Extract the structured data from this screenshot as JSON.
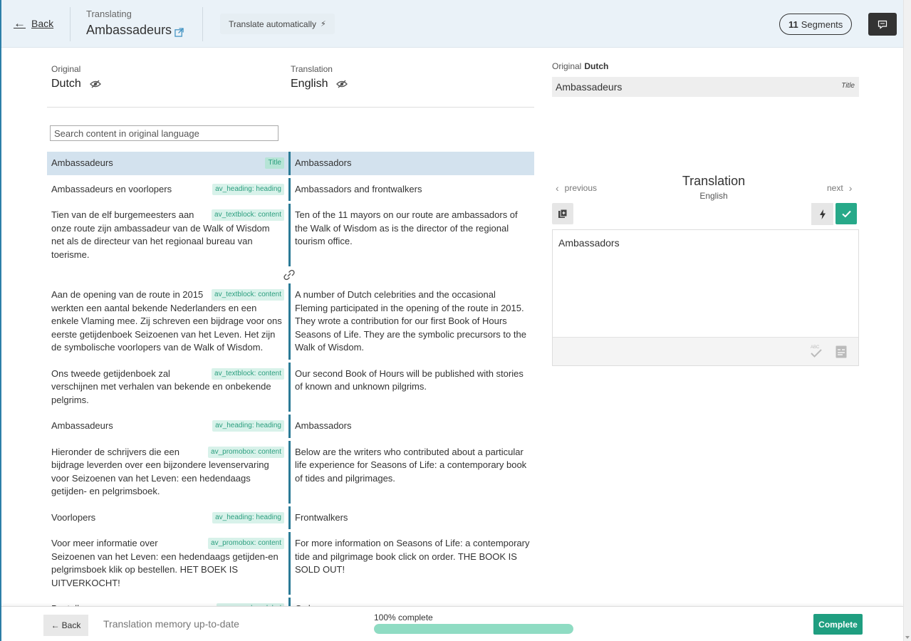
{
  "header": {
    "back_label": "Back",
    "translating_label": "Translating",
    "title": "Ambassadeurs",
    "translate_auto_label": "Translate automatically",
    "segments_count": "11",
    "segments_label": "Segments"
  },
  "languages": {
    "original_label": "Original",
    "original_name": "Dutch",
    "translation_label": "Translation",
    "translation_name": "English"
  },
  "search": {
    "placeholder": "Search content in original language"
  },
  "segments": [
    {
      "original": "Ambassadeurs",
      "tag": "Title",
      "translation": "Ambassadors",
      "selected": true
    },
    {
      "original": "Ambassadeurs en voorlopers",
      "tag": "av_heading: heading",
      "translation": "Ambassadors and frontwalkers"
    },
    {
      "original": "Tien van de elf burgemeesters aan onze route zijn ambassadeur van de Walk of Wisdom net als de directeur van het regionaal bureau van toerisme.",
      "tag": "av_textblock: content",
      "translation": "Ten of the 11 mayors on our route are ambassadors of the Walk of Wisdom as is the director of the regional tourism office."
    },
    {
      "original": "Aan de opening van de route in 2015 werkten een aantal bekende Nederlanders en een enkele Vlaming mee. Zij schreven een bijdrage voor ons eerste getijdenboek Seizoenen van het Leven. Het zijn de symbolische voorlopers van de Walk of Wisdom.",
      "tag": "av_textblock: content",
      "translation": "A number of Dutch celebrities and the occasional Fleming participated in the opening of the route in 2015. They wrote a contribution for our first Book of Hours Seasons of Life. They are the symbolic precursors to the Walk of Wisdom."
    },
    {
      "original": "Ons tweede getijdenboek zal verschijnen met verhalen van bekende en onbekende pelgrims.",
      "tag": "av_textblock: content",
      "translation": "Our second Book of Hours will be published with stories of known and unknown pilgrims."
    },
    {
      "original": "Ambassadeurs",
      "tag": "av_heading: heading",
      "translation": "Ambassadors"
    },
    {
      "original": "Hieronder de schrijvers die een bijdrage leverden over een bijzondere levenservaring voor Seizoenen van het Leven: een hedendaags getijden- en pelgrimsboek.",
      "tag": "av_promobox: content",
      "translation": "Below are the writers who contributed about a particular life experience for Seasons of Life: a contemporary book of tides and pilgrimages."
    },
    {
      "original": "Voorlopers",
      "tag": "av_heading: heading",
      "translation": "Frontwalkers"
    },
    {
      "original": "Voor meer informatie over Seizoenen van het Leven: een hedendaags getijden-en pelgrimsboek klik op bestellen. HET BOEK IS UITVERKOCHT!",
      "tag": "av_promobox: content",
      "translation": "For more information on Seasons of Life: a contemporary tide and pilgrimage book click on order. THE BOOK IS SOLD OUT!"
    },
    {
      "original": "Bestellen",
      "tag": "av_promobox: label",
      "translation": "Order"
    }
  ],
  "right_panel": {
    "original_label": "Original",
    "original_lang": "Dutch",
    "original_text": "Ambassadeurs",
    "original_tag": "Title",
    "previous_label": "previous",
    "next_label": "next",
    "translation_title": "Translation",
    "translation_lang": "English",
    "editor_value": "Ambassadors"
  },
  "footer": {
    "back_label": "Back",
    "tm_status": "Translation memory up-to-date",
    "progress_label": "100% complete",
    "progress_percent": 100,
    "complete_label": "Complete"
  },
  "colors": {
    "accent": "#27a989",
    "header_bg": "#eaf2f8",
    "segment_divider": "#2b7a96",
    "selected_row": "#d3e2ee",
    "progress_fill": "#8fdcc3"
  }
}
